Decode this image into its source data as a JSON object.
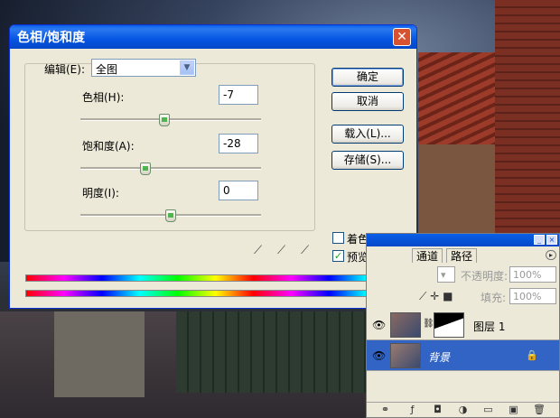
{
  "dialog": {
    "title": "色相/饱和度",
    "edit_label": "编辑(E):",
    "edit_value": "全图",
    "hue_label": "色相(H):",
    "hue_value": "-7",
    "saturation_label": "饱和度(A):",
    "saturation_value": "-28",
    "lightness_label": "明度(I):",
    "lightness_value": "0",
    "buttons": {
      "ok": "确定",
      "cancel": "取消",
      "load": "载入(L)...",
      "save": "存储(S)..."
    },
    "colorize_label": "着色(O)",
    "colorize_checked": false,
    "preview_label": "预览(P)",
    "preview_checked": true
  },
  "layers_panel": {
    "tabs": [
      "通道",
      "路径"
    ],
    "opacity_label": "不透明度:",
    "opacity_value": "100%",
    "fill_label": "填充:",
    "fill_value": "100%",
    "layers": [
      {
        "name": "图层 1",
        "selected": false
      },
      {
        "name": "背景",
        "selected": true
      }
    ]
  },
  "icons": [
    "close-icon",
    "chevron-down-icon",
    "eyedropper-icon",
    "eyedropper-plus-icon",
    "eyedropper-minus-icon",
    "eye-icon",
    "lock-icon",
    "link-icon",
    "trash-icon"
  ],
  "colors": {
    "titlebar": "#0555e3",
    "dialog_bg": "#ece9d8",
    "selected_layer": "#3164c5"
  }
}
